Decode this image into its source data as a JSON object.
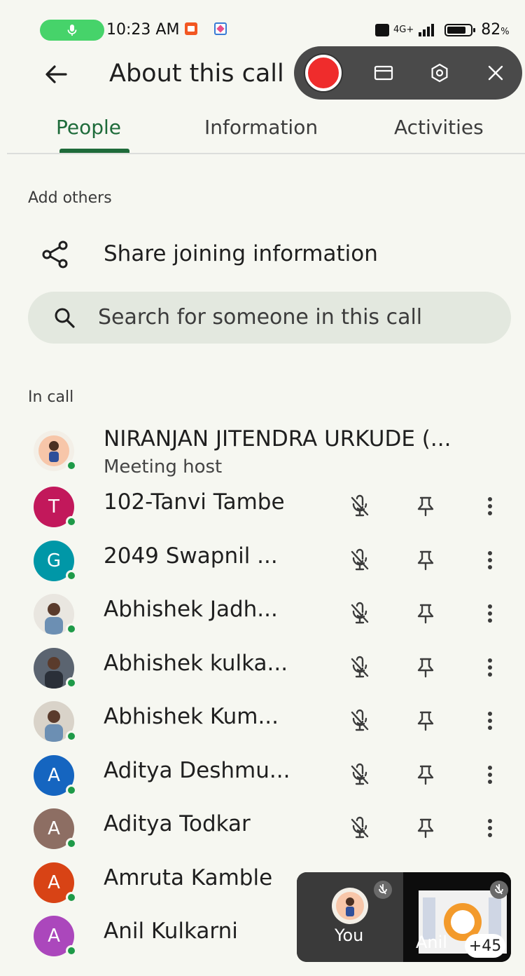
{
  "status_bar": {
    "time": "10:23 AM",
    "network": "4G+",
    "battery_level": 0.82,
    "battery_text": "82",
    "battery_unit": "%"
  },
  "header": {
    "title": "About this call"
  },
  "tabs": [
    {
      "label": "People",
      "active": true
    },
    {
      "label": "Information",
      "active": false
    },
    {
      "label": "Activities",
      "active": false
    }
  ],
  "add_others": {
    "label": "Add others",
    "share_label": "Share joining information"
  },
  "search": {
    "placeholder": "Search for someone in this call"
  },
  "in_call": {
    "label": "In call",
    "host": {
      "name": "NIRANJAN JITENDRA URKUDE (...",
      "role": "Meeting host"
    },
    "participants": [
      {
        "name": "102-Tanvi Tambe",
        "initial": "T",
        "color": "#c2185b"
      },
      {
        "name": "2049 Swapnil ...",
        "initial": "G",
        "color": "#0097a7"
      },
      {
        "name": "Abhishek Jadh...",
        "initial": "",
        "color": "#e9e6e0"
      },
      {
        "name": "Abhishek kulka...",
        "initial": "",
        "color": "#5b6470"
      },
      {
        "name": "Abhishek Kum...",
        "initial": "",
        "color": "#d9d3c9"
      },
      {
        "name": "Aditya Deshmu...",
        "initial": "A",
        "color": "#1565c0"
      },
      {
        "name": "Aditya Todkar",
        "initial": "A",
        "color": "#8d6e63"
      },
      {
        "name": "Amruta Kamble",
        "initial": "A",
        "color": "#d84315"
      },
      {
        "name": "Anil Kulkarni",
        "initial": "A",
        "color": "#ab47bc"
      }
    ]
  },
  "pip": {
    "you_label": "You",
    "other_label": "Anil",
    "more_count": "+45"
  }
}
